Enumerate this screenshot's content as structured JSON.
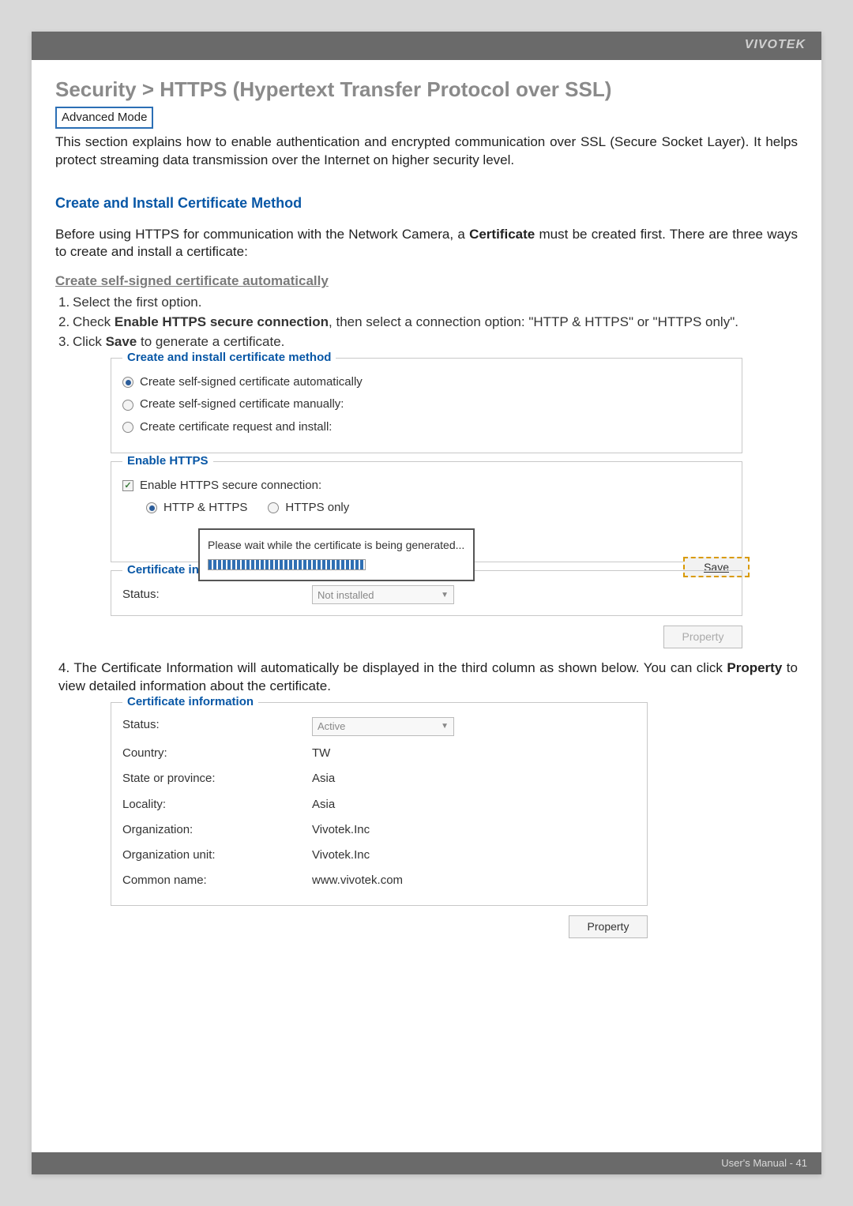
{
  "header": {
    "brand": "VIVOTEK"
  },
  "title": "Security >  HTTPS (Hypertext Transfer Protocol over SSL)",
  "mode_badge": "Advanced Mode",
  "intro": "This section explains how to enable authentication and encrypted communication over SSL (Secure Socket Layer). It helps protect streaming data transmission over the Internet on higher security level.",
  "section_heading": "Create and Install Certificate Method",
  "lead_text_1": "Before using HTTPS for communication with the Network Camera, a ",
  "lead_strong": "Certificate",
  "lead_text_2": " must be created first. There are three ways to create and install a certificate:",
  "sub_head": "Create self-signed certificate automatically",
  "steps": [
    {
      "n": "1.",
      "t": "Select the first option."
    },
    {
      "n": "2.",
      "t_pre": "Check ",
      "strong": "Enable HTTPS secure connection",
      "t_post": ", then select a connection option: \"HTTP & HTTPS\" or \"HTTPS only\"."
    },
    {
      "n": "3.",
      "t_pre": "Click ",
      "strong": "Save",
      "t_post": " to generate a certificate."
    }
  ],
  "ui1": {
    "legend_method": "Create and install certificate method",
    "opt1": "Create self-signed certificate automatically",
    "opt2": "Create self-signed certificate manually:",
    "opt3": "Create certificate request and install:",
    "legend_enable": "Enable HTTPS",
    "check_enable": "Enable HTTPS secure connection:",
    "conn1": "HTTP & HTTPS",
    "conn2": "HTTPS only",
    "modal_text": "Please wait while the certificate is being generated...",
    "save_label": "Save",
    "legend_certinfo": "Certificate information",
    "status_label": "Status:",
    "status_value": "Not installed",
    "property_label": "Property"
  },
  "step4_pre": "4. The Certificate Information will automatically be displayed in the third column as shown below. You can click ",
  "step4_strong": "Property",
  "step4_post": " to view detailed information about the certificate.",
  "ui2": {
    "legend": "Certificate information",
    "rows": [
      {
        "k": "Status:",
        "v": "Active",
        "dropdown": true
      },
      {
        "k": "Country:",
        "v": "TW"
      },
      {
        "k": "State or province:",
        "v": "Asia"
      },
      {
        "k": "Locality:",
        "v": "Asia"
      },
      {
        "k": "Organization:",
        "v": "Vivotek.Inc"
      },
      {
        "k": "Organization unit:",
        "v": "Vivotek.Inc"
      },
      {
        "k": "Common name:",
        "v": "www.vivotek.com"
      }
    ],
    "property_label": "Property"
  },
  "footer": "User's Manual - 41"
}
